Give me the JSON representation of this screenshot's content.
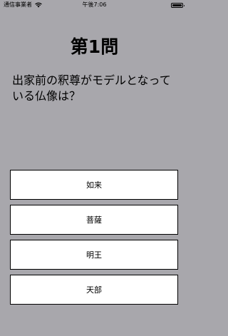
{
  "status_bar": {
    "carrier": "通信事業者",
    "time": "午後7:06",
    "wifi_icon": "wifi-icon",
    "battery_icon": "battery-icon",
    "battery_level": 1.0
  },
  "quiz": {
    "question_number": "第1問",
    "question_text": "出家前の釈尊がモデルとなっている仏像は？",
    "answers": [
      "如来",
      "菩薩",
      "明王",
      "天部"
    ]
  }
}
